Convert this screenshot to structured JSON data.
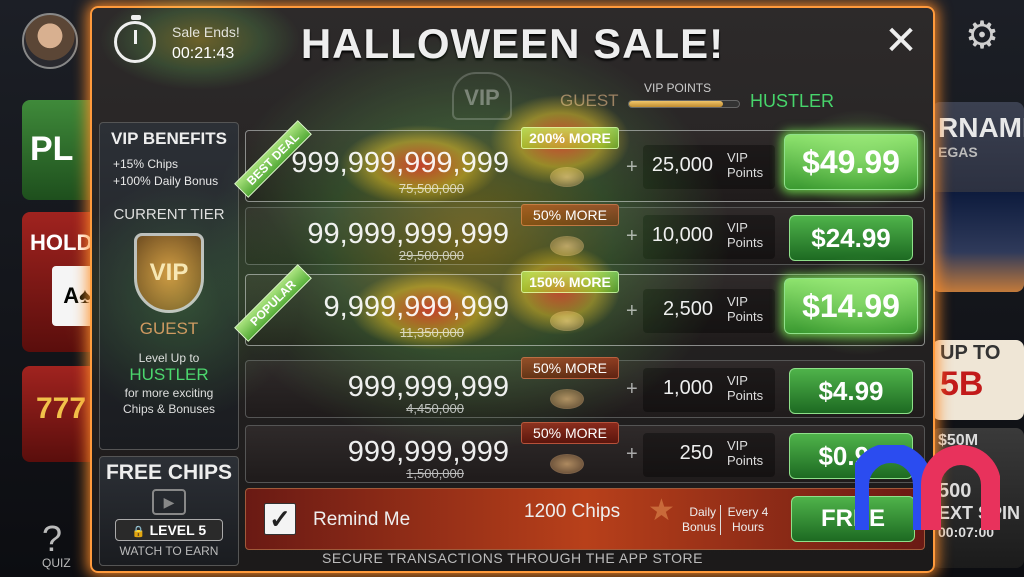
{
  "header": {
    "sale_ends_label": "Sale Ends!",
    "sale_time": "00:21:43",
    "title": "HALLOWEEN SALE!",
    "close_glyph": "✕"
  },
  "vip": {
    "current_tier": "GUEST",
    "next_tier": "HUSTLER",
    "points_label": "VIP POINTS",
    "progress_percent": 85,
    "badge_text": "VIP"
  },
  "benefits": {
    "title": "VIP BENEFITS",
    "lines": [
      "+15% Chips",
      "+100% Daily Bonus"
    ],
    "current_tier_label": "CURRENT TIER",
    "shield_text": "VIP",
    "tier_name": "GUEST",
    "level_up_prefix": "Level Up to",
    "level_up_tier": "HUSTLER",
    "level_up_suffix_1": "for more exciting",
    "level_up_suffix_2": "Chips & Bonuses"
  },
  "free_chips": {
    "title": "FREE CHIPS",
    "level_label": "LEVEL 5",
    "watch_label": "WATCH TO EARN"
  },
  "offers": [
    {
      "ribbon": "BEST DEAL",
      "chips": "999,999,999,999",
      "old": "75,500,000",
      "more": "200% MORE",
      "more_style": "green",
      "points": "25,000",
      "points_label_1": "VIP",
      "points_label_2": "Points",
      "price": "$49.99",
      "highlight": true
    },
    {
      "ribbon": "",
      "chips": "99,999,999,999",
      "old": "29,500,000",
      "more": "50% MORE",
      "more_style": "red",
      "points": "10,000",
      "points_label_1": "VIP",
      "points_label_2": "Points",
      "price": "$24.99",
      "highlight": false
    },
    {
      "ribbon": "POPULAR",
      "chips": "9,999,999,999",
      "old": "11,350,000",
      "more": "150% MORE",
      "more_style": "green",
      "points": "2,500",
      "points_label_1": "VIP",
      "points_label_2": "Points",
      "price": "$14.99",
      "highlight": true
    },
    {
      "ribbon": "",
      "chips": "999,999,999",
      "old": "4,450,000",
      "more": "50% MORE",
      "more_style": "red",
      "points": "1,000",
      "points_label_1": "VIP",
      "points_label_2": "Points",
      "price": "$4.99",
      "highlight": false
    },
    {
      "ribbon": "",
      "chips": "999,999,999",
      "old": "1,500,000",
      "more": "50% MORE",
      "more_style": "red",
      "points": "250",
      "points_label_1": "VIP",
      "points_label_2": "Points",
      "price": "$0.99",
      "highlight": false
    }
  ],
  "remind": {
    "checked": true,
    "label": "Remind Me",
    "chips": "1200 Chips",
    "daily_1": "Daily",
    "daily_2": "Bonus",
    "every_1": "Every 4",
    "every_2": "Hours",
    "button": "FREE"
  },
  "footer": {
    "secure_text": "SECURE TRANSACTIONS THROUGH THE APP STORE"
  },
  "background": {
    "play_label": "PL",
    "holdem_label": "HOLD",
    "tournament_label": "RNAMENT",
    "tournament_sub": "EGAS",
    "upto_label": "UP TO",
    "upto_value": "5B",
    "spin_amount": "$50M",
    "spin_label_1": "500",
    "spin_label_2": "EXT SPIN",
    "spin_time": "00:07:00",
    "quiz_label": "QUIZ"
  },
  "colors": {
    "accent_green": "#47d46b",
    "frame_orange": "#ff9a3c",
    "logo_blue": "#2b4cf0",
    "logo_pink": "#e8325c"
  },
  "icons": [
    "timer-icon",
    "close-icon",
    "gear-icon",
    "checkbox-icon",
    "video-icon",
    "lock-icon",
    "coin-stack-icon",
    "vip-shield-icon"
  ]
}
